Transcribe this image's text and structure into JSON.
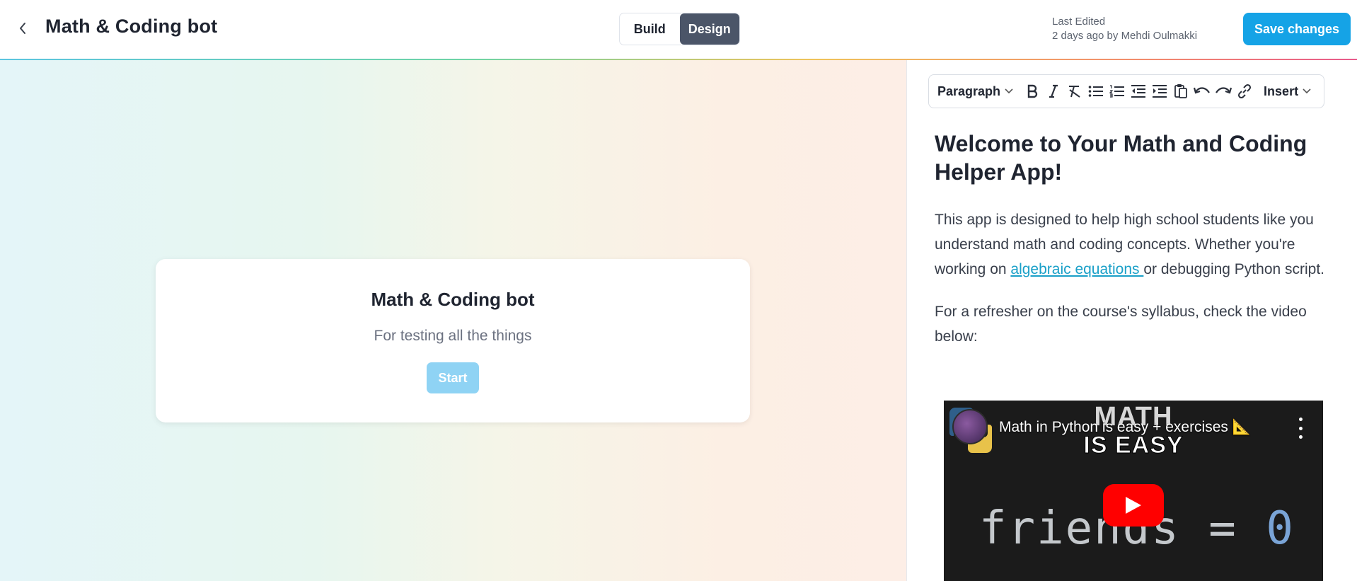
{
  "header": {
    "back_icon": "chevron-left-icon",
    "title": "Math & Coding bot",
    "mode_toggle": [
      {
        "label": "Build",
        "active": false
      },
      {
        "label": "Design",
        "active": true
      }
    ],
    "last_edited_label": "Last Edited",
    "last_edited_value": "2 days ago by Mehdi Oulmakki",
    "save_label": "Save changes"
  },
  "preview": {
    "card_title": "Math & Coding bot",
    "card_subtitle": "For testing all the things",
    "start_label": "Start"
  },
  "editor": {
    "toolbar": {
      "block_format": "Paragraph",
      "insert_label": "Insert",
      "icons": [
        "bold-icon",
        "italic-icon",
        "clear-format-icon",
        "bullet-list-icon",
        "numbered-list-icon",
        "outdent-icon",
        "indent-icon",
        "paste-icon",
        "undo-icon",
        "redo-icon",
        "link-icon"
      ]
    },
    "heading": "Welcome to Your Math and Coding Helper App!",
    "paragraph1_before": "This app is designed to help high school students like you understand math and coding concepts. Whether you're working on ",
    "paragraph1_link": "algebraic equations ",
    "paragraph1_after": "or debugging Python script.",
    "paragraph2": "For a refresher on the course's syllabus, check the video below:",
    "video": {
      "title": "Math in Python is easy + exercises 📐",
      "thumb_text_1": "MATH",
      "thumb_text_2": "IS EASY",
      "code_text": "friends = ",
      "code_number": "0"
    }
  },
  "colors": {
    "accent": "#15a3e6",
    "toggle_active": "#4b5568",
    "link": "#1aa0c8",
    "start_button": "#8fd3f4"
  }
}
